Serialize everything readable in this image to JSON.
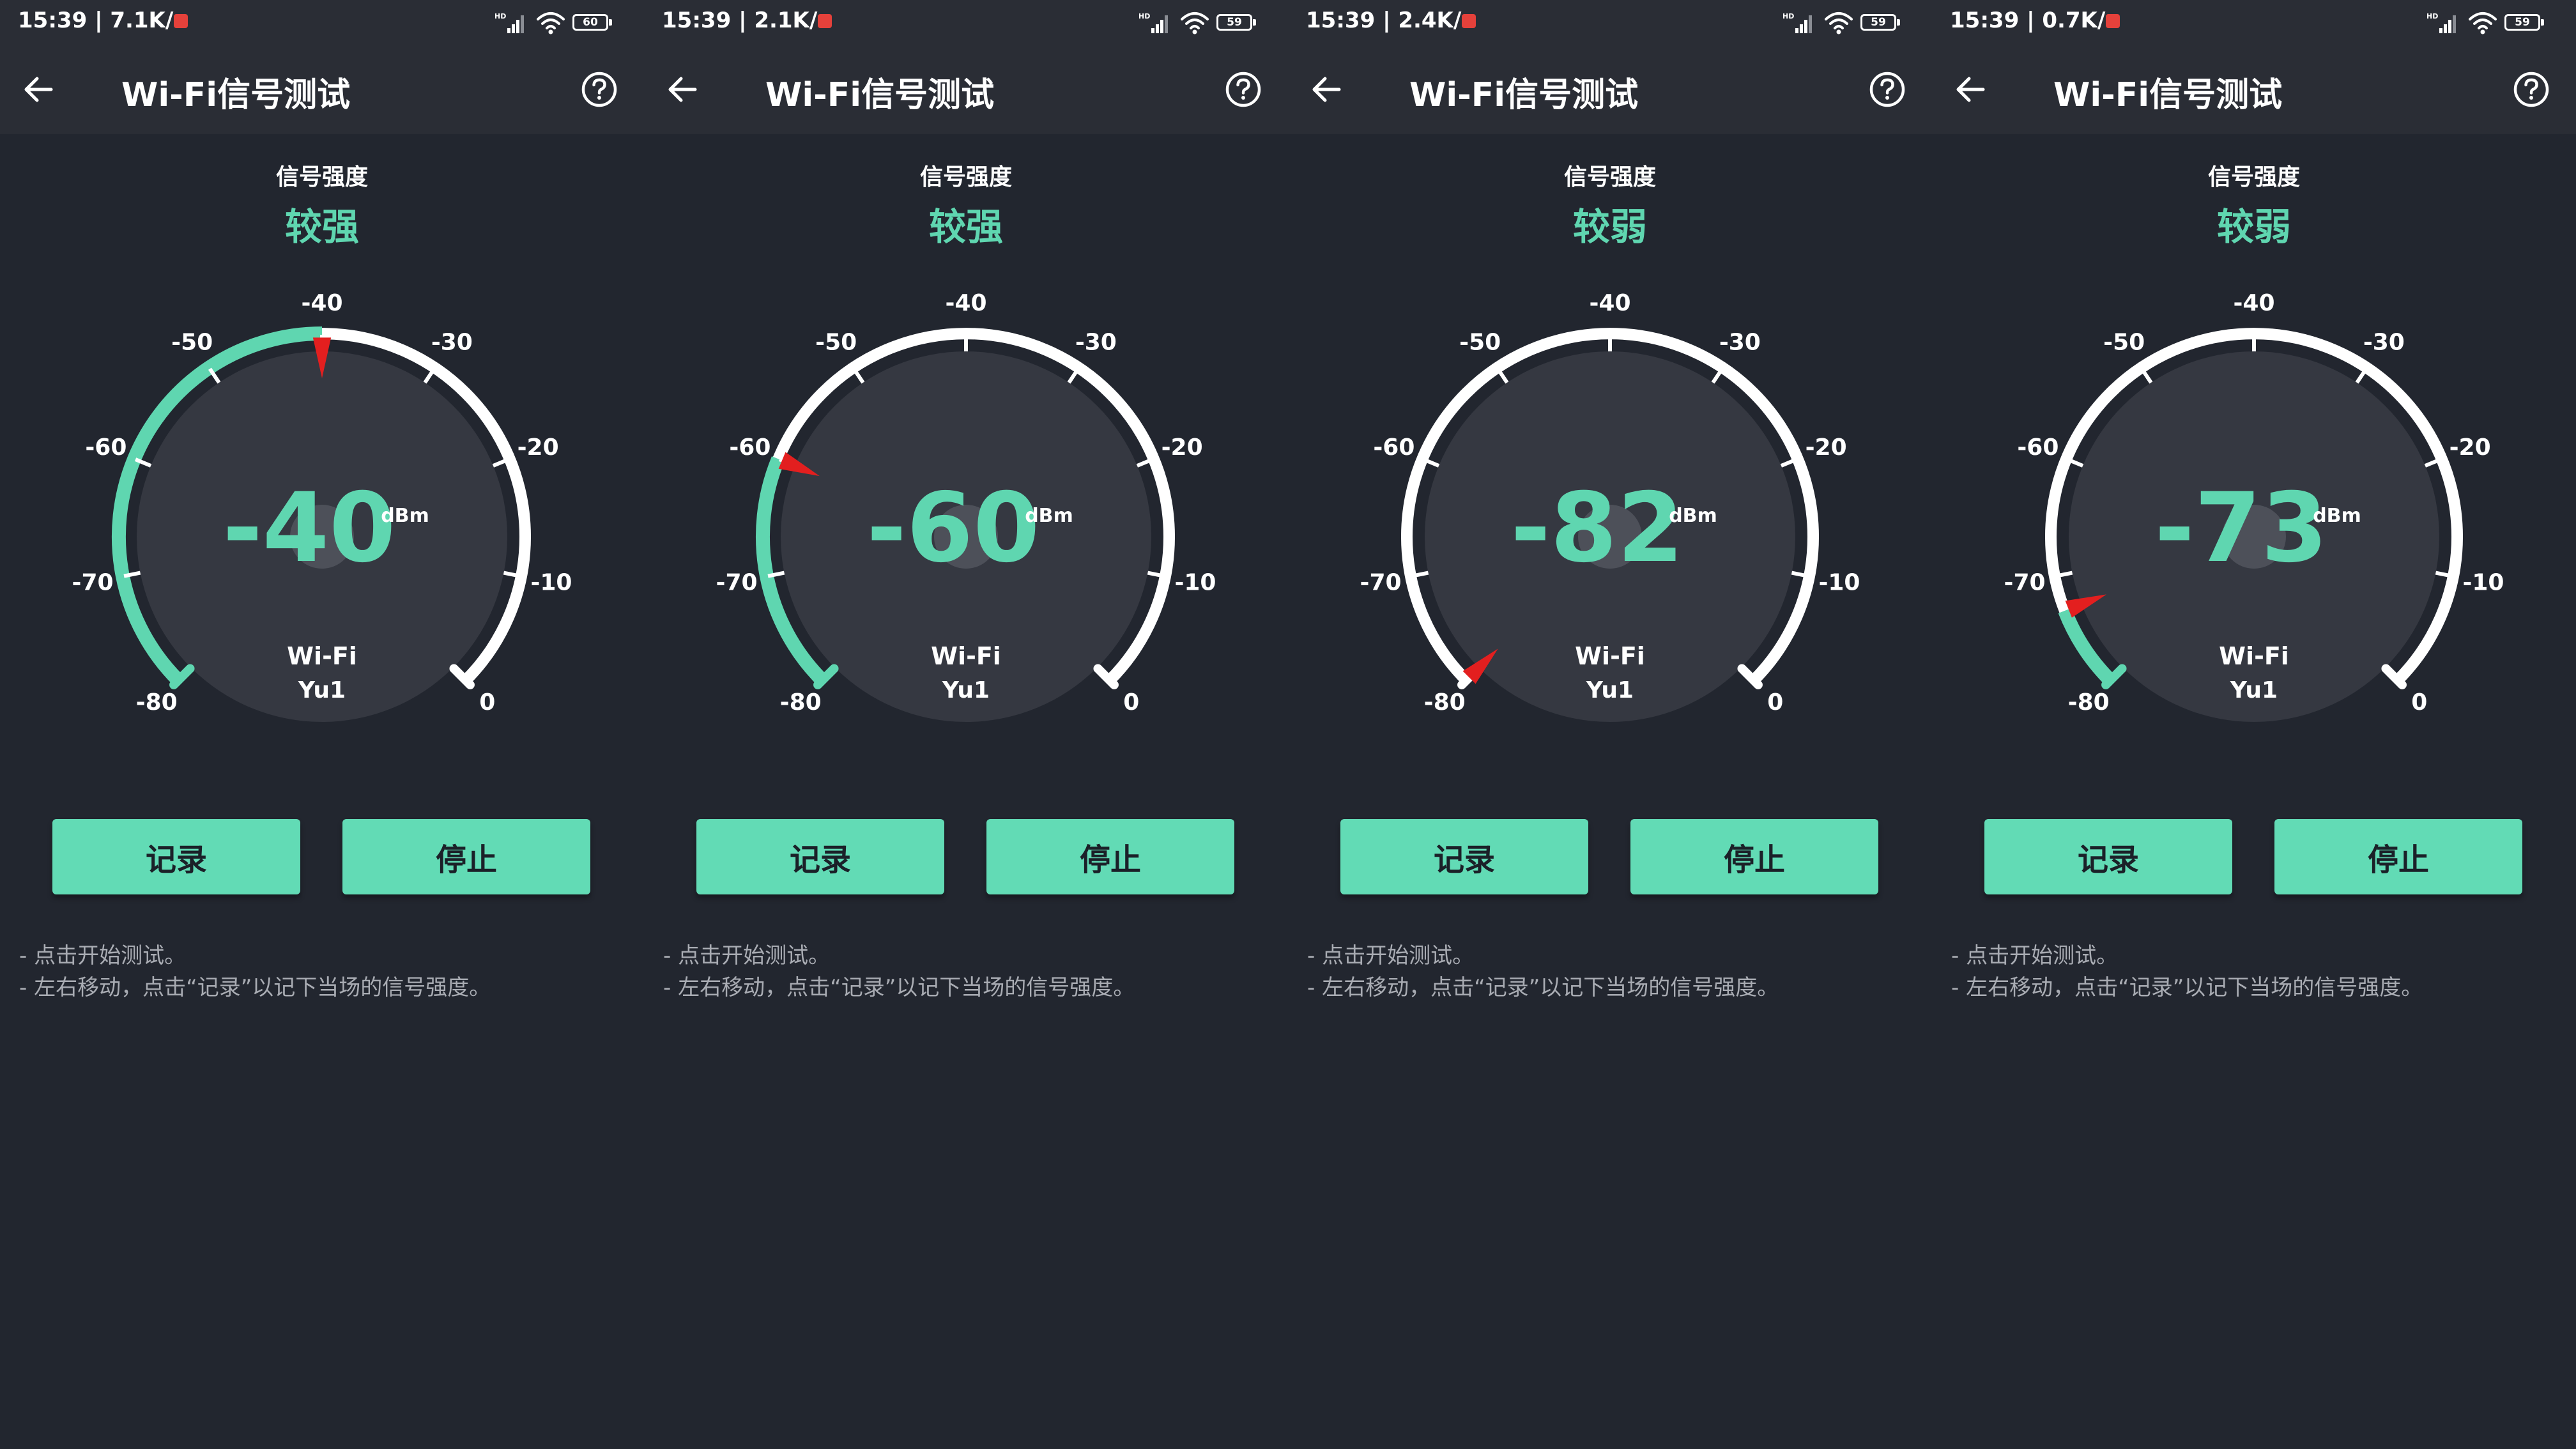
{
  "gauge": {
    "min": -80,
    "max": 0,
    "ticks": [
      "-80",
      "-70",
      "-60",
      "-50",
      "-40",
      "-30",
      "-20",
      "-10",
      "0"
    ],
    "unit": "dBm"
  },
  "colors": {
    "accent": "#5fd6b0",
    "needle": "#e31f1f",
    "track": "#ffffff",
    "button": "#62dbb5"
  },
  "screens": [
    {
      "status": {
        "time": "15:39 | 7.1K/s",
        "battery": "60"
      },
      "header": {
        "title": "Wi-Fi信号测试",
        "back_icon": "arrow-left-icon",
        "help_icon": "question-circle-icon"
      },
      "signal": {
        "label": "信号强度",
        "level": "较强",
        "reading": "-40",
        "value": -40,
        "network_type": "Wi-Fi",
        "ssid": "Yu1"
      },
      "buttons": {
        "record": "记录",
        "stop": "停止"
      },
      "hints": [
        "- 点击开始测试。",
        "- 左右移动，点击“记录”以记下当场的信号强度。"
      ]
    },
    {
      "status": {
        "time": "15:39 | 2.1K/s",
        "battery": "59"
      },
      "header": {
        "title": "Wi-Fi信号测试",
        "back_icon": "arrow-left-icon",
        "help_icon": "question-circle-icon"
      },
      "signal": {
        "label": "信号强度",
        "level": "较强",
        "reading": "-60",
        "value": -60,
        "network_type": "Wi-Fi",
        "ssid": "Yu1"
      },
      "buttons": {
        "record": "记录",
        "stop": "停止"
      },
      "hints": [
        "- 点击开始测试。",
        "- 左右移动，点击“记录”以记下当场的信号强度。"
      ]
    },
    {
      "status": {
        "time": "15:39 | 2.4K/s",
        "battery": "59"
      },
      "header": {
        "title": "Wi-Fi信号测试",
        "back_icon": "arrow-left-icon",
        "help_icon": "question-circle-icon"
      },
      "signal": {
        "label": "信号强度",
        "level": "较弱",
        "reading": "-82",
        "value": -82,
        "network_type": "Wi-Fi",
        "ssid": "Yu1"
      },
      "buttons": {
        "record": "记录",
        "stop": "停止"
      },
      "hints": [
        "- 点击开始测试。",
        "- 左右移动，点击“记录”以记下当场的信号强度。"
      ]
    },
    {
      "status": {
        "time": "15:39 | 0.7K/s",
        "battery": "59"
      },
      "header": {
        "title": "Wi-Fi信号测试",
        "back_icon": "arrow-left-icon",
        "help_icon": "question-circle-icon"
      },
      "signal": {
        "label": "信号强度",
        "level": "较弱",
        "reading": "-73",
        "value": -73,
        "network_type": "Wi-Fi",
        "ssid": "Yu1"
      },
      "buttons": {
        "record": "记录",
        "stop": "停止"
      },
      "hints": [
        "- 点击开始测试。",
        "- 左右移动，点击“记录”以记下当场的信号强度。"
      ]
    }
  ]
}
